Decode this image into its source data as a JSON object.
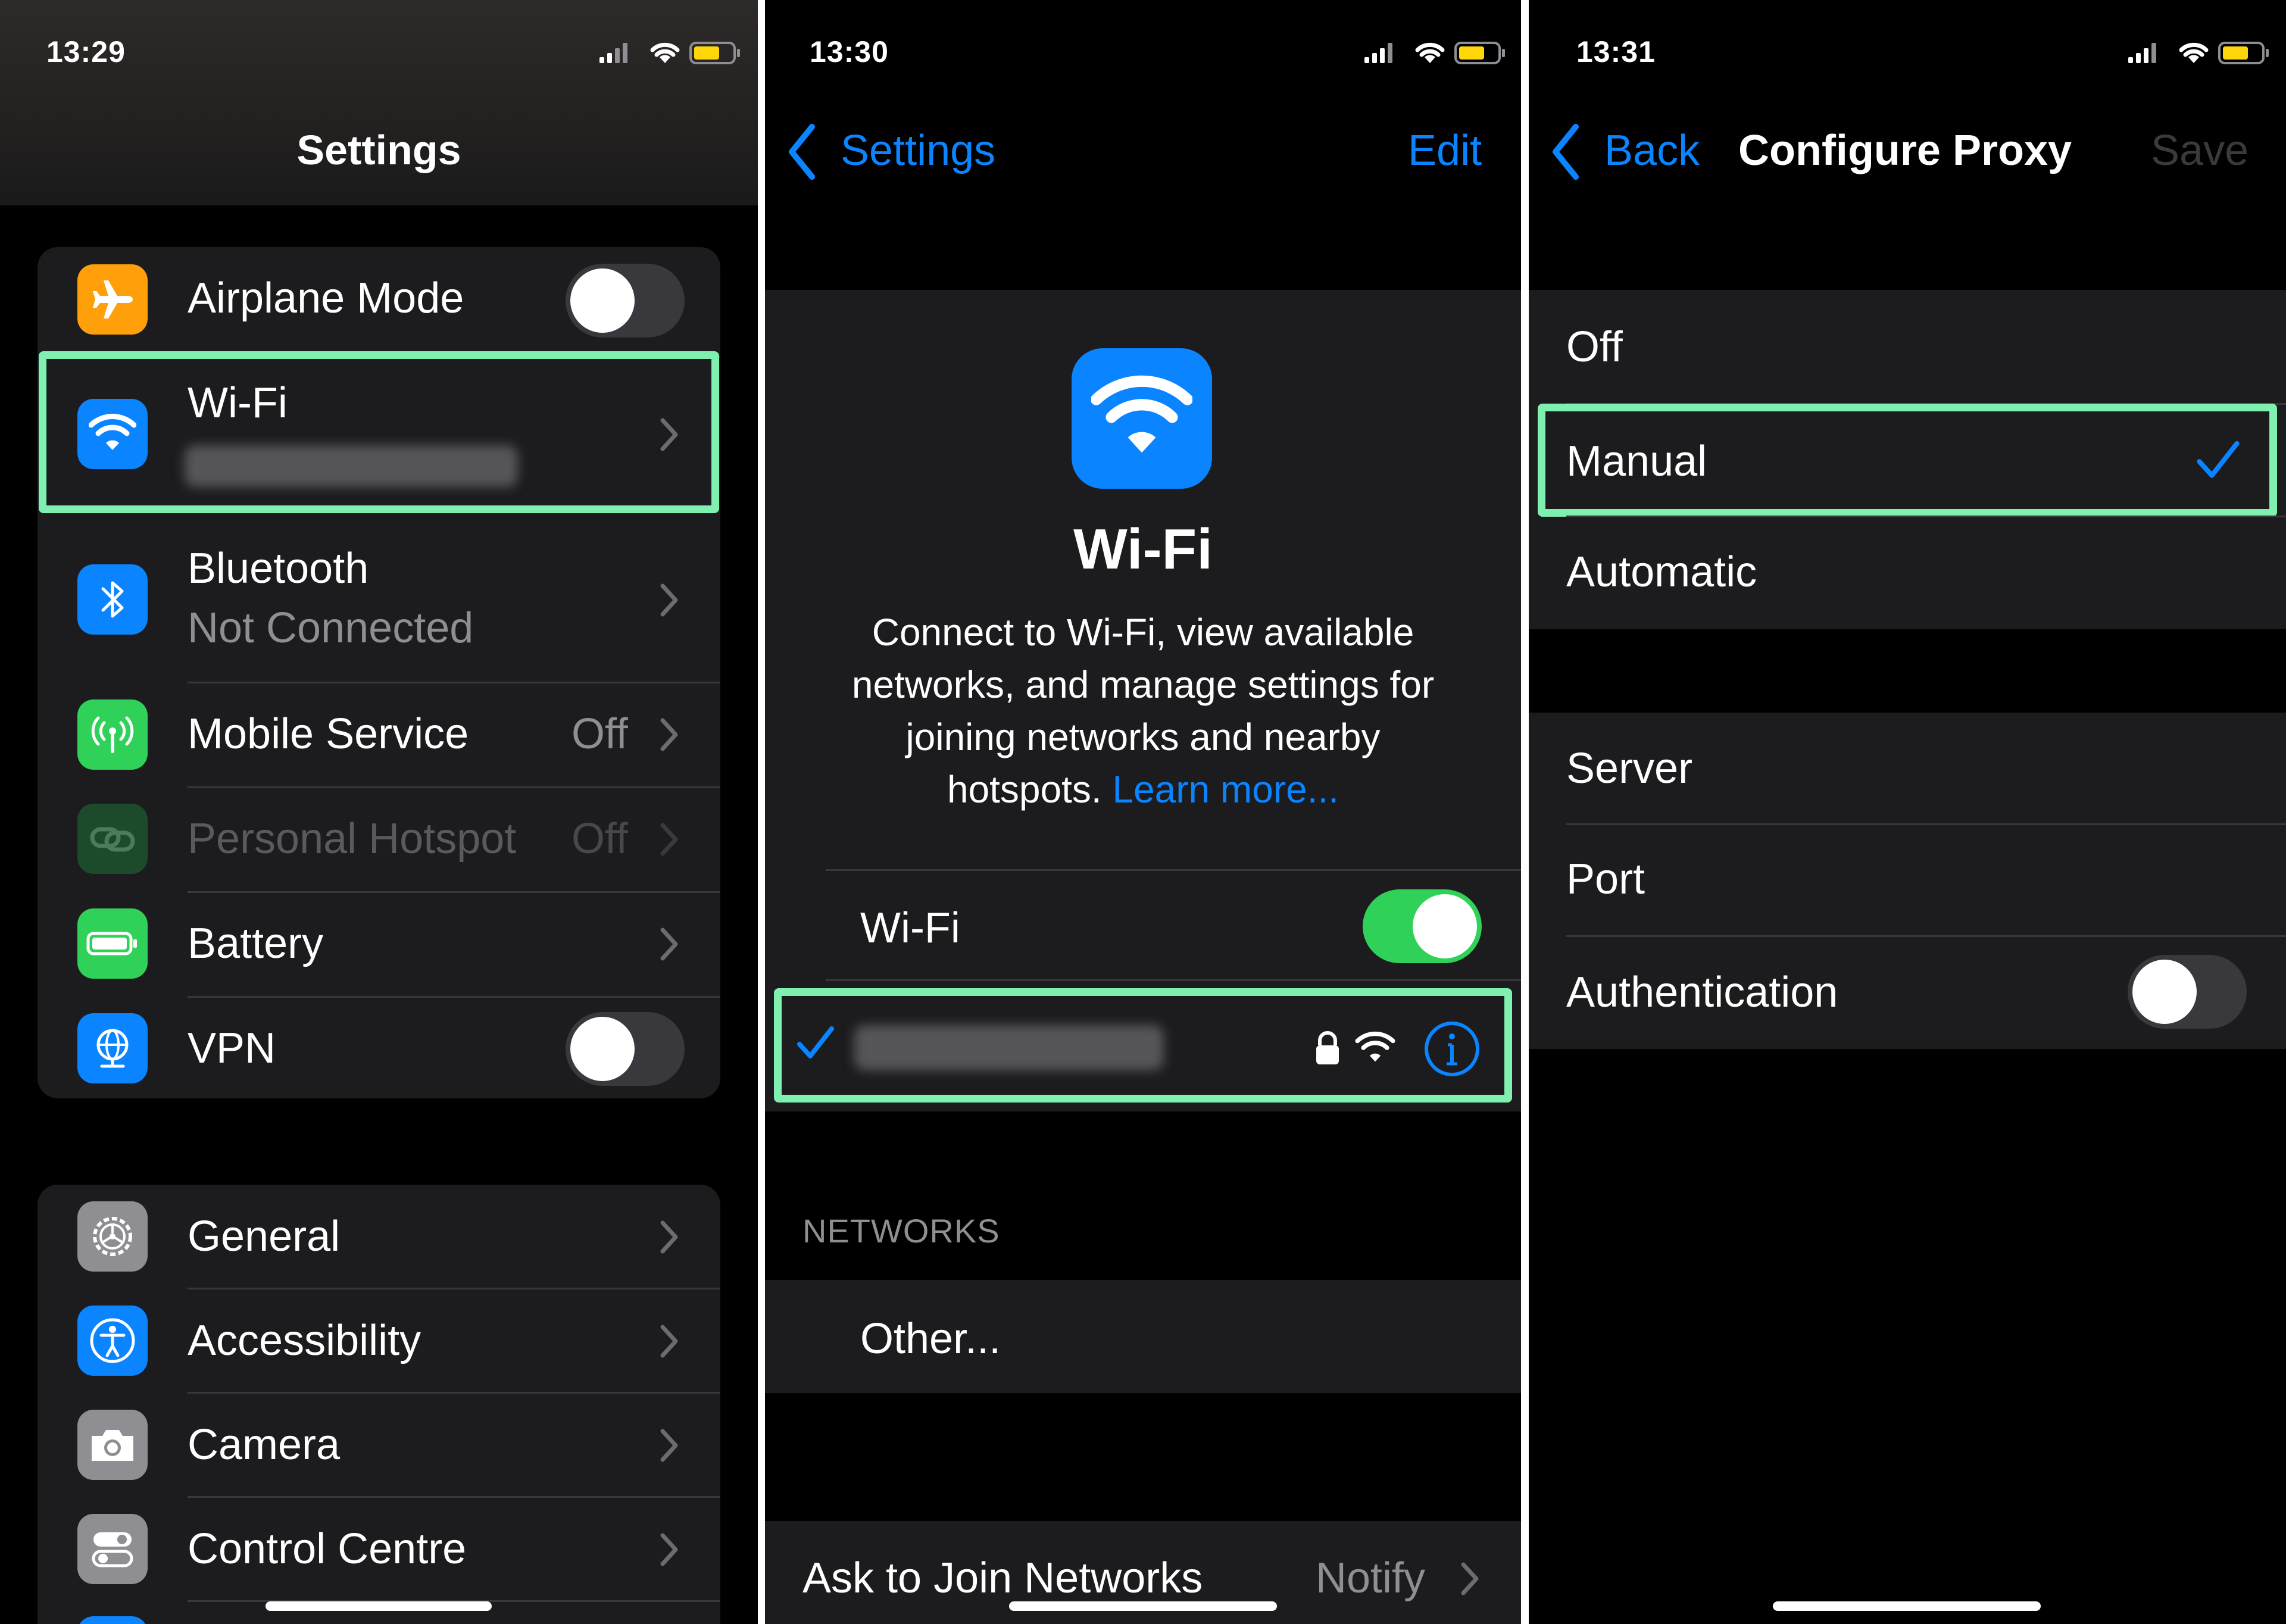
{
  "colors": {
    "accent": "#0a84ff",
    "highlight": "#7ff0b0",
    "toggle_on": "#30d158",
    "airplane": "#ff9f0a",
    "wifi": "#0a84ff",
    "bluetooth": "#0a84ff",
    "mobile": "#30d158",
    "hotspot": "#1d4a2a",
    "battery": "#30d158",
    "vpn": "#0a84ff",
    "general": "#8e8e93",
    "accessibility": "#0a84ff",
    "camera": "#8e8e93",
    "control": "#8e8e93",
    "battery_level": "#ffd60a"
  },
  "panel1": {
    "time": "13:29",
    "title": "Settings",
    "rows": [
      {
        "icon": "airplane-icon",
        "label": "Airplane Mode",
        "control": "toggle",
        "on": false
      },
      {
        "icon": "wifi-icon",
        "label": "Wi-Fi",
        "sublabel": "[blurred network name]",
        "highlighted": true
      },
      {
        "icon": "bluetooth-icon",
        "label": "Bluetooth",
        "sublabel": "Not Connected"
      },
      {
        "icon": "antenna-icon",
        "label": "Mobile Service",
        "value": "Off"
      },
      {
        "icon": "link-icon",
        "label": "Personal Hotspot",
        "value": "Off",
        "disabled": true
      },
      {
        "icon": "battery-icon",
        "label": "Battery"
      },
      {
        "icon": "globe-icon",
        "label": "VPN",
        "control": "toggle",
        "on": false
      }
    ],
    "rows2": [
      {
        "icon": "gear-icon",
        "label": "General"
      },
      {
        "icon": "accessibility-icon",
        "label": "Accessibility"
      },
      {
        "icon": "camera-icon",
        "label": "Camera"
      },
      {
        "icon": "switches-icon",
        "label": "Control Centre"
      }
    ]
  },
  "panel2": {
    "time": "13:30",
    "back": "Settings",
    "edit": "Edit",
    "hero_title": "Wi-Fi",
    "description": "Connect to Wi-Fi, view available networks, and manage settings for joining networks and nearby hotspots.",
    "desc_lines": [
      "Connect to Wi-Fi, view available",
      "networks, and manage settings for",
      "joining networks and nearby",
      "hotspots."
    ],
    "learn_more": "Learn more...",
    "wifi_label": "Wi-Fi",
    "wifi_on": true,
    "connected_network": "[blurred network name]",
    "section_header": "NETWORKS",
    "other": "Other...",
    "ask_join": "Ask to Join Networks",
    "ask_join_value": "Notify"
  },
  "panel3": {
    "time": "13:31",
    "back": "Back",
    "title": "Configure Proxy",
    "save": "Save",
    "options": [
      {
        "label": "Off",
        "selected": false
      },
      {
        "label": "Manual",
        "selected": true
      },
      {
        "label": "Automatic",
        "selected": false
      }
    ],
    "fields": [
      {
        "label": "Server"
      },
      {
        "label": "Port"
      },
      {
        "label": "Authentication",
        "control": "toggle",
        "on": false
      }
    ]
  }
}
